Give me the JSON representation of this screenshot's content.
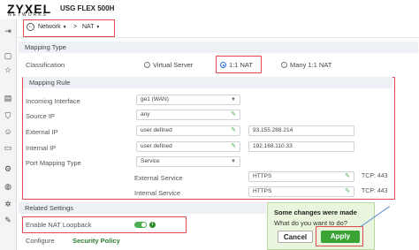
{
  "header": {
    "brand": "ZYXEL",
    "brand_sub": "NETWORKS",
    "model": "USG FLEX 500H"
  },
  "breadcrumb": {
    "items": [
      "Network",
      "NAT"
    ],
    "separator": ">"
  },
  "mapping_type": {
    "title": "Mapping Type",
    "classification_label": "Classification",
    "options": [
      "Virtual Server",
      "1:1 NAT",
      "Many 1:1 NAT"
    ],
    "selected": "1:1 NAT"
  },
  "mapping_rule": {
    "title": "Mapping Rule",
    "incoming_interface": {
      "label": "Incoming Interface",
      "value": "ge1 (WAN)"
    },
    "source_ip": {
      "label": "Source IP",
      "value": "any"
    },
    "external_ip": {
      "label": "External IP",
      "value": "user defined",
      "address": "93.155.288.214"
    },
    "internal_ip": {
      "label": "Internal IP",
      "value": "user defined",
      "address": "192.168.110.33"
    },
    "port_mapping_type": {
      "label": "Port Mapping Type",
      "value": "Service"
    },
    "external_service": {
      "label": "External Service",
      "value": "HTTPS",
      "port": "TCP: 443"
    },
    "internal_service": {
      "label": "Internal Service",
      "value": "HTTPS",
      "port": "TCP: 443"
    }
  },
  "related_settings": {
    "title": "Related Settings",
    "nat_loopback_label": "Enable NAT Loopback",
    "nat_loopback_on": true,
    "configure_label": "Configure",
    "security_policy_link": "Security Policy"
  },
  "popup": {
    "title": "Some changes were made",
    "question": "What do you want to do?",
    "cancel_label": "Cancel",
    "apply_label": "Apply"
  },
  "colors": {
    "accent_green": "#3aa335",
    "highlight_red": "#e0484b",
    "callout_blue": "#5a8fd6",
    "section_bg": "#edf0f4"
  },
  "icons": {
    "sidebar": [
      "menu-collapse-icon",
      "dashboard-icon",
      "star-icon",
      "monitor-icon",
      "shield-icon",
      "user-icon",
      "document-icon",
      "settings-icon",
      "globe-icon",
      "gear-icon",
      "wrench-icon"
    ]
  }
}
